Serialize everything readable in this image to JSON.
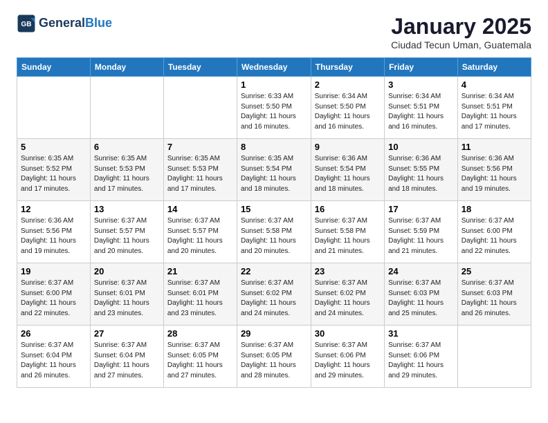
{
  "logo": {
    "general": "General",
    "blue": "Blue"
  },
  "header": {
    "title": "January 2025",
    "subtitle": "Ciudad Tecun Uman, Guatemala"
  },
  "weekdays": [
    "Sunday",
    "Monday",
    "Tuesday",
    "Wednesday",
    "Thursday",
    "Friday",
    "Saturday"
  ],
  "weeks": [
    [
      {
        "day": "",
        "info": ""
      },
      {
        "day": "",
        "info": ""
      },
      {
        "day": "",
        "info": ""
      },
      {
        "day": "1",
        "info": "Sunrise: 6:33 AM\nSunset: 5:50 PM\nDaylight: 11 hours and 16 minutes."
      },
      {
        "day": "2",
        "info": "Sunrise: 6:34 AM\nSunset: 5:50 PM\nDaylight: 11 hours and 16 minutes."
      },
      {
        "day": "3",
        "info": "Sunrise: 6:34 AM\nSunset: 5:51 PM\nDaylight: 11 hours and 16 minutes."
      },
      {
        "day": "4",
        "info": "Sunrise: 6:34 AM\nSunset: 5:51 PM\nDaylight: 11 hours and 17 minutes."
      }
    ],
    [
      {
        "day": "5",
        "info": "Sunrise: 6:35 AM\nSunset: 5:52 PM\nDaylight: 11 hours and 17 minutes."
      },
      {
        "day": "6",
        "info": "Sunrise: 6:35 AM\nSunset: 5:53 PM\nDaylight: 11 hours and 17 minutes."
      },
      {
        "day": "7",
        "info": "Sunrise: 6:35 AM\nSunset: 5:53 PM\nDaylight: 11 hours and 17 minutes."
      },
      {
        "day": "8",
        "info": "Sunrise: 6:35 AM\nSunset: 5:54 PM\nDaylight: 11 hours and 18 minutes."
      },
      {
        "day": "9",
        "info": "Sunrise: 6:36 AM\nSunset: 5:54 PM\nDaylight: 11 hours and 18 minutes."
      },
      {
        "day": "10",
        "info": "Sunrise: 6:36 AM\nSunset: 5:55 PM\nDaylight: 11 hours and 18 minutes."
      },
      {
        "day": "11",
        "info": "Sunrise: 6:36 AM\nSunset: 5:56 PM\nDaylight: 11 hours and 19 minutes."
      }
    ],
    [
      {
        "day": "12",
        "info": "Sunrise: 6:36 AM\nSunset: 5:56 PM\nDaylight: 11 hours and 19 minutes."
      },
      {
        "day": "13",
        "info": "Sunrise: 6:37 AM\nSunset: 5:57 PM\nDaylight: 11 hours and 20 minutes."
      },
      {
        "day": "14",
        "info": "Sunrise: 6:37 AM\nSunset: 5:57 PM\nDaylight: 11 hours and 20 minutes."
      },
      {
        "day": "15",
        "info": "Sunrise: 6:37 AM\nSunset: 5:58 PM\nDaylight: 11 hours and 20 minutes."
      },
      {
        "day": "16",
        "info": "Sunrise: 6:37 AM\nSunset: 5:58 PM\nDaylight: 11 hours and 21 minutes."
      },
      {
        "day": "17",
        "info": "Sunrise: 6:37 AM\nSunset: 5:59 PM\nDaylight: 11 hours and 21 minutes."
      },
      {
        "day": "18",
        "info": "Sunrise: 6:37 AM\nSunset: 6:00 PM\nDaylight: 11 hours and 22 minutes."
      }
    ],
    [
      {
        "day": "19",
        "info": "Sunrise: 6:37 AM\nSunset: 6:00 PM\nDaylight: 11 hours and 22 minutes."
      },
      {
        "day": "20",
        "info": "Sunrise: 6:37 AM\nSunset: 6:01 PM\nDaylight: 11 hours and 23 minutes."
      },
      {
        "day": "21",
        "info": "Sunrise: 6:37 AM\nSunset: 6:01 PM\nDaylight: 11 hours and 23 minutes."
      },
      {
        "day": "22",
        "info": "Sunrise: 6:37 AM\nSunset: 6:02 PM\nDaylight: 11 hours and 24 minutes."
      },
      {
        "day": "23",
        "info": "Sunrise: 6:37 AM\nSunset: 6:02 PM\nDaylight: 11 hours and 24 minutes."
      },
      {
        "day": "24",
        "info": "Sunrise: 6:37 AM\nSunset: 6:03 PM\nDaylight: 11 hours and 25 minutes."
      },
      {
        "day": "25",
        "info": "Sunrise: 6:37 AM\nSunset: 6:03 PM\nDaylight: 11 hours and 26 minutes."
      }
    ],
    [
      {
        "day": "26",
        "info": "Sunrise: 6:37 AM\nSunset: 6:04 PM\nDaylight: 11 hours and 26 minutes."
      },
      {
        "day": "27",
        "info": "Sunrise: 6:37 AM\nSunset: 6:04 PM\nDaylight: 11 hours and 27 minutes."
      },
      {
        "day": "28",
        "info": "Sunrise: 6:37 AM\nSunset: 6:05 PM\nDaylight: 11 hours and 27 minutes."
      },
      {
        "day": "29",
        "info": "Sunrise: 6:37 AM\nSunset: 6:05 PM\nDaylight: 11 hours and 28 minutes."
      },
      {
        "day": "30",
        "info": "Sunrise: 6:37 AM\nSunset: 6:06 PM\nDaylight: 11 hours and 29 minutes."
      },
      {
        "day": "31",
        "info": "Sunrise: 6:37 AM\nSunset: 6:06 PM\nDaylight: 11 hours and 29 minutes."
      },
      {
        "day": "",
        "info": ""
      }
    ]
  ]
}
